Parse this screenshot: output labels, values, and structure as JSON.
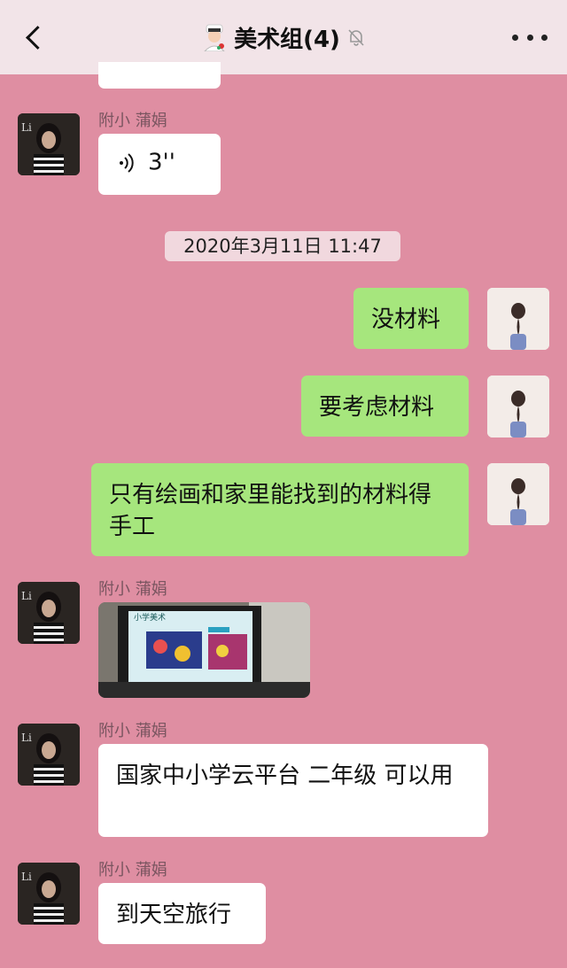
{
  "header": {
    "title": "美术组(4)",
    "back_icon": "chevron-left-icon",
    "group_icon": "chef-emoji-icon",
    "mute_icon": "bell-slash-icon",
    "more_icon": "more-dots-icon"
  },
  "messages": [
    {
      "sender": "附小 蒲娟",
      "type": "voice",
      "duration": "3''"
    },
    {
      "timestamp": "2020年3月11日 11:47"
    },
    {
      "sender": "me",
      "text": "没材料"
    },
    {
      "sender": "me",
      "text": "要考虑材料"
    },
    {
      "sender": "me",
      "text": "只有绘画和家里能找到的材料得手工"
    },
    {
      "sender": "附小 蒲娟",
      "type": "image",
      "image_text": "小学美术"
    },
    {
      "sender": "附小 蒲娟",
      "text": "国家中小学云平台 二年级 可以用"
    },
    {
      "sender": "附小 蒲娟",
      "text": "到天空旅行"
    }
  ],
  "colors": {
    "background": "#df8ea2",
    "header_bg": "#f2e4e8",
    "outgoing_bubble": "#a6e67d",
    "incoming_bubble": "#ffffff"
  }
}
